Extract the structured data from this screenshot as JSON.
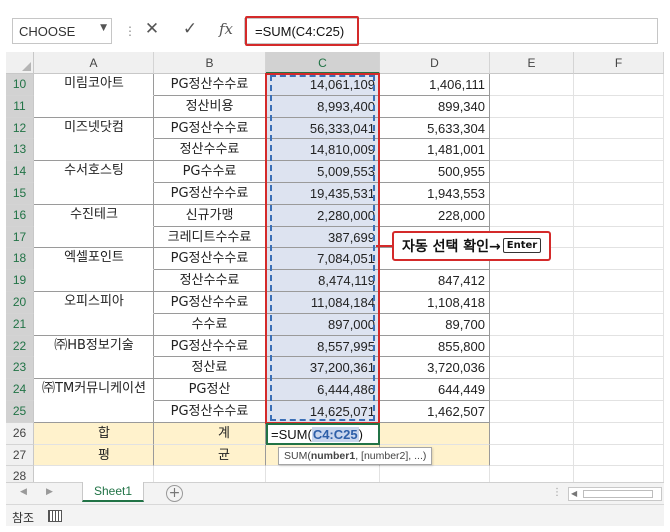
{
  "name_box": {
    "value": "CHOOSE"
  },
  "formula_bar": {
    "formula": "=SUM(C4:C25)"
  },
  "columns": [
    "A",
    "B",
    "C",
    "D",
    "E",
    "F"
  ],
  "rows": [
    {
      "num": "10",
      "b": "PG정산수수료",
      "c": "14,061,109",
      "d": "1,406,111"
    },
    {
      "num": "11",
      "b": "정산비용",
      "c": "8,993,400",
      "d": "899,340"
    },
    {
      "num": "12",
      "b": "PG정산수수료",
      "c": "56,333,041",
      "d": "5,633,304"
    },
    {
      "num": "13",
      "b": "정산수수료",
      "c": "14,810,009",
      "d": "1,481,001"
    },
    {
      "num": "14",
      "b": "PG수수료",
      "c": "5,009,553",
      "d": "500,955"
    },
    {
      "num": "15",
      "b": "PG정산수수료",
      "c": "19,435,531",
      "d": "1,943,553"
    },
    {
      "num": "16",
      "b": "신규가맹",
      "c": "2,280,000",
      "d": "228,000"
    },
    {
      "num": "17",
      "b": "크레디트수수료",
      "c": "387,699",
      "d": ""
    },
    {
      "num": "18",
      "b": "PG정산수수료",
      "c": "7,084,051",
      "d": ""
    },
    {
      "num": "19",
      "b": "정산수수료",
      "c": "8,474,119",
      "d": "847,412"
    },
    {
      "num": "20",
      "b": "PG정산수수료",
      "c": "11,084,184",
      "d": "1,108,418"
    },
    {
      "num": "21",
      "b": "수수료",
      "c": "897,000",
      "d": "89,700"
    },
    {
      "num": "22",
      "b": "PG정산수수료",
      "c": "8,557,995",
      "d": "855,800"
    },
    {
      "num": "23",
      "b": "정산료",
      "c": "37,200,361",
      "d": "3,720,036"
    },
    {
      "num": "24",
      "b": "PG정산",
      "c": "6,444,486",
      "d": "644,449"
    },
    {
      "num": "25",
      "b": "PG정산수수료",
      "c": "14,625,071",
      "d": "1,462,507"
    },
    {
      "num": "26",
      "b": "",
      "c": "",
      "d": ""
    },
    {
      "num": "27",
      "b": "",
      "c": "",
      "d": ""
    },
    {
      "num": "28",
      "b": "",
      "c": "",
      "d": ""
    }
  ],
  "company_groups": [
    {
      "name": "미림코아트",
      "first_row": 0
    },
    {
      "name": "미즈넷닷컴",
      "first_row": 2
    },
    {
      "name": "수서호스팅",
      "first_row": 4
    },
    {
      "name": "수진테크",
      "first_row": 6
    },
    {
      "name": "엑셀포인트",
      "first_row": 8
    },
    {
      "name": "오피스피아",
      "first_row": 10
    },
    {
      "name": "㈜HB정보기술",
      "first_row": 12
    },
    {
      "name": "㈜TM커뮤니케이션",
      "first_row": 14
    }
  ],
  "total_row": {
    "label_1": "합",
    "label_2": "계",
    "active_formula_prefix": "=SUM(",
    "active_formula_ref": "C4:C25",
    "active_formula_suffix": ")"
  },
  "avg_row": {
    "label_1": "평",
    "label_2": "균"
  },
  "tooltip": {
    "fn": "SUM(",
    "arg1": "number1",
    "rest": ", [number2], ...)"
  },
  "callout": {
    "text": "자동 선택 확인→",
    "key": "Enter"
  },
  "sheet_tabs": [
    {
      "label": "Sheet1"
    }
  ],
  "status": {
    "mode": "참조"
  },
  "colors": {
    "accent": "#217346",
    "highlight": "#d42a2a",
    "range_fill": "#dde3f0",
    "total_fill": "#fff2cc"
  }
}
